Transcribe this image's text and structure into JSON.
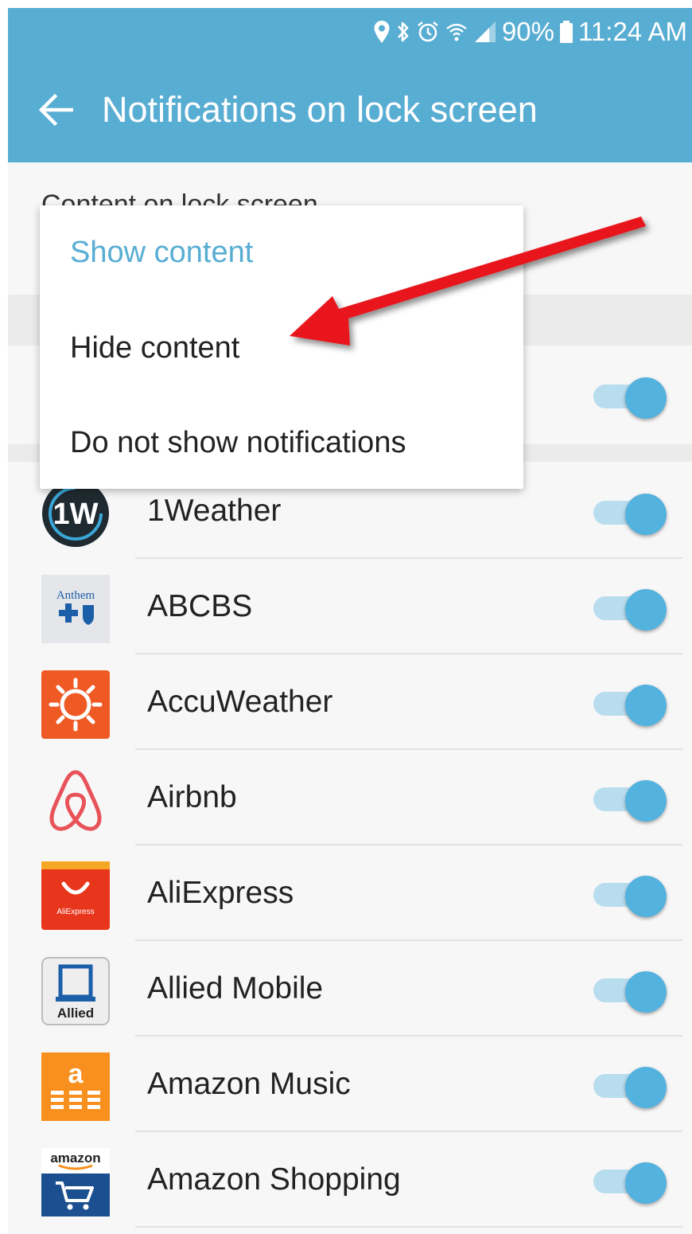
{
  "status_bar": {
    "icons": [
      "location-icon",
      "bluetooth-icon",
      "alarm-icon",
      "wifi-icon",
      "signal-icon",
      "battery-icon"
    ],
    "battery": "90%",
    "time": "11:24 AM"
  },
  "header": {
    "title": "Notifications on lock screen",
    "back_icon": "back-arrow-icon"
  },
  "section": {
    "label": "Content on lock screen"
  },
  "dropdown": {
    "options": [
      {
        "label": "Show content",
        "selected": true
      },
      {
        "label": "Hide content",
        "selected": false
      },
      {
        "label": "Do not show notifications",
        "selected": false
      }
    ]
  },
  "apps": [
    {
      "name": "1Weather",
      "icon": "1weather-icon",
      "enabled": true
    },
    {
      "name": "ABCBS",
      "icon": "anthem-icon",
      "icon_text": "Anthem",
      "enabled": true
    },
    {
      "name": "AccuWeather",
      "icon": "accuweather-sun-icon",
      "enabled": true
    },
    {
      "name": "Airbnb",
      "icon": "airbnb-icon",
      "enabled": true
    },
    {
      "name": "AliExpress",
      "icon": "aliexpress-icon",
      "icon_text": "AliExpress",
      "enabled": true
    },
    {
      "name": "Allied Mobile",
      "icon": "allied-icon",
      "icon_text": "Allied",
      "enabled": true
    },
    {
      "name": "Amazon Music",
      "icon": "amazon-music-icon",
      "icon_text": "a",
      "enabled": true
    },
    {
      "name": "Amazon Shopping",
      "icon": "amazon-cart-icon",
      "icon_text": "amazon",
      "enabled": true
    }
  ],
  "colors": {
    "accent": "#58add3",
    "toggle_thumb": "#54b2df",
    "toggle_track": "#b8ddef",
    "annotation_arrow": "#e8141b"
  }
}
